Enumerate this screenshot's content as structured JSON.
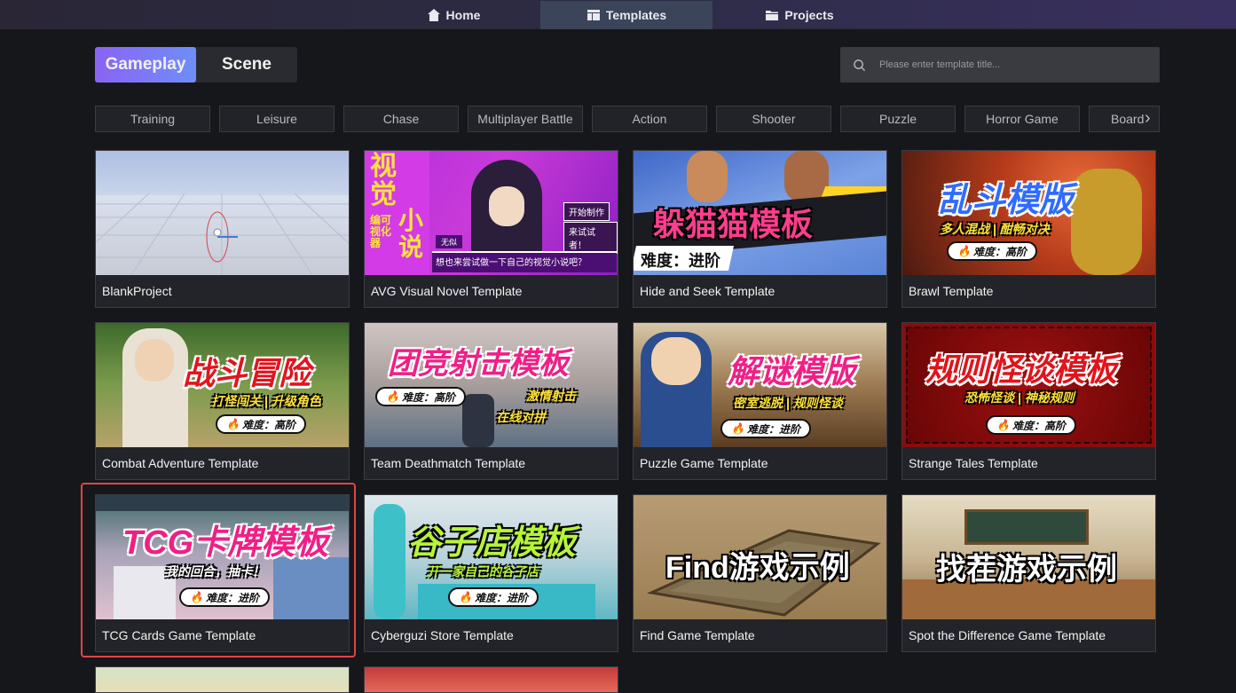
{
  "nav": {
    "tabs": [
      {
        "label": "Home",
        "icon": "home-icon"
      },
      {
        "label": "Templates",
        "icon": "templates-icon"
      },
      {
        "label": "Projects",
        "icon": "folder-icon"
      }
    ],
    "active": "Templates"
  },
  "mode": {
    "gameplay": "Gameplay",
    "scene": "Scene",
    "active": "Gameplay"
  },
  "search": {
    "placeholder": "Please enter template title..."
  },
  "categories": [
    "Training",
    "Leisure",
    "Chase",
    "Multiplayer Battle",
    "Action",
    "Shooter",
    "Puzzle",
    "Horror Game",
    "Board"
  ],
  "cards": [
    {
      "title": "BlankProject"
    },
    {
      "title": "AVG Visual Novel Template",
      "art": {
        "vert1": "视觉",
        "vert2": "小说",
        "side": "编可视化器",
        "btn1": "开始制作",
        "btn2": "来试试者！",
        "tag": "无似",
        "line": "想也来尝试做一下自己的视觉小说吧？"
      }
    },
    {
      "title": "Hide and Seek Template",
      "art": {
        "headline": "躲猫猫模板",
        "level": "难度：进阶"
      }
    },
    {
      "title": "Brawl Template",
      "art": {
        "headline": "乱斗模版",
        "sub": "多人混战 | 酣畅对决",
        "pill": "难度：高阶"
      }
    },
    {
      "title": "Combat Adventure Template",
      "art": {
        "headline": "战斗冒险",
        "sub": "打怪闯关 | 升级角色",
        "pill": "难度：高阶"
      }
    },
    {
      "title": "Team Deathmatch Template",
      "art": {
        "headline": "团竞射击模板",
        "pill": "难度：高阶",
        "sub1": "激情射击",
        "sub2": "在线对拼"
      }
    },
    {
      "title": "Puzzle Game Template",
      "art": {
        "headline": "解谜模版",
        "sub": "密室逃脱 | 规则怪谈",
        "pill": "难度：进阶"
      }
    },
    {
      "title": "Strange Tales Template",
      "art": {
        "headline": "规则怪谈模板",
        "sub": "恐怖怪谈 | 神秘规则",
        "pill": "难度：高阶"
      }
    },
    {
      "title": "TCG Cards Game Template",
      "art": {
        "headline": "TCG卡牌模板",
        "sub": "我的回合，抽卡！",
        "pill": "难度：进阶"
      }
    },
    {
      "title": "Cyberguzi Store Template",
      "art": {
        "headline": "谷子店模板",
        "sub": "开一家自己的谷子店",
        "pill": "难度：进阶"
      }
    },
    {
      "title": "Find Game Template",
      "art": {
        "headline": "Find游戏示例"
      }
    },
    {
      "title": "Spot the Difference Game Template",
      "art": {
        "headline": "找茬游戏示例"
      }
    }
  ],
  "selected_card": "TCG Cards Game Template",
  "colors": {
    "accent_start": "#8a63f5",
    "accent_end": "#6f8ef8",
    "selection": "#e04545",
    "background": "#16171b"
  }
}
